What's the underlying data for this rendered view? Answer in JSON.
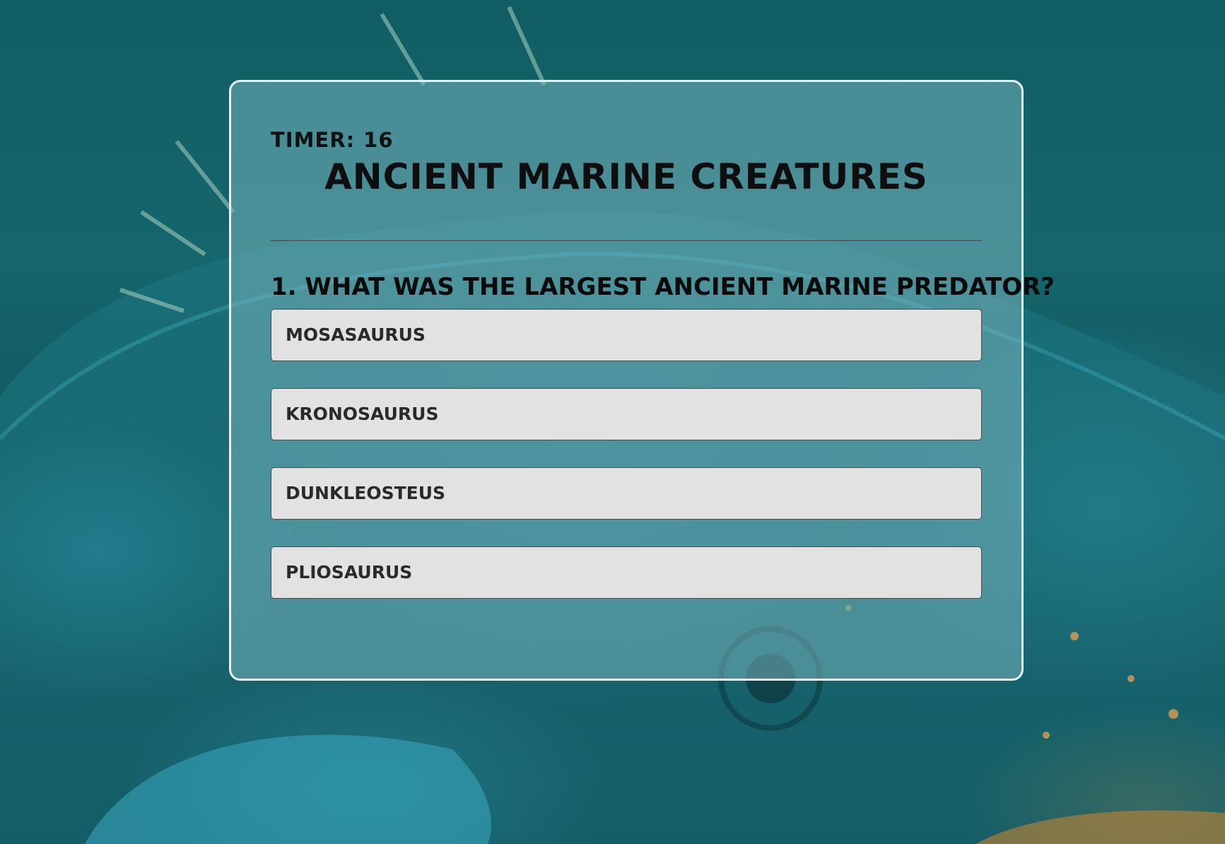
{
  "quiz": {
    "timer_label": "Timer:",
    "timer_value": "16",
    "title": "Ancient Marine Creatures",
    "question": "1. What was the largest ancient marine predator?",
    "answers": [
      {
        "label": "Mosasaurus"
      },
      {
        "label": "Kronosaurus"
      },
      {
        "label": "Dunkleosteus"
      },
      {
        "label": "Pliosaurus"
      }
    ]
  },
  "colors": {
    "background": "#125f66",
    "card_border": "#e8f1f2",
    "answer_background": "#e2e2e2",
    "text": "#111111"
  }
}
